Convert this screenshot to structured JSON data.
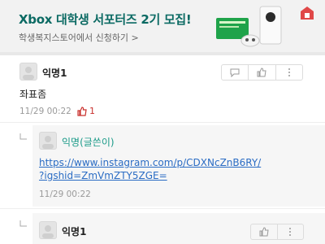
{
  "banner": {
    "title": "Xbox 대학생 서포터즈 2기 모집!",
    "subtitle": "학생복지스토어에서 신청하기 >"
  },
  "comments": [
    {
      "author": "익명1",
      "text": "좌표좀",
      "time": "11/29 00:22",
      "likes": "1"
    },
    {
      "author": "익명(글쓴이)",
      "link_line1": "https://www.instagram.com/p/CDXNcZnB6RY/",
      "link_line2": "?igshid=ZmVmZTY5ZGE=",
      "time": "11/29 00:22"
    },
    {
      "author": "익명1"
    }
  ],
  "icons": [
    "comment-icon",
    "thumbs-up-icon",
    "more-icon",
    "reply-arrow-icon",
    "like-icon"
  ],
  "colors": {
    "accent": "#0b6a63",
    "op_name": "#1a9a88",
    "link": "#2a6cc4",
    "like": "#c9302c"
  }
}
